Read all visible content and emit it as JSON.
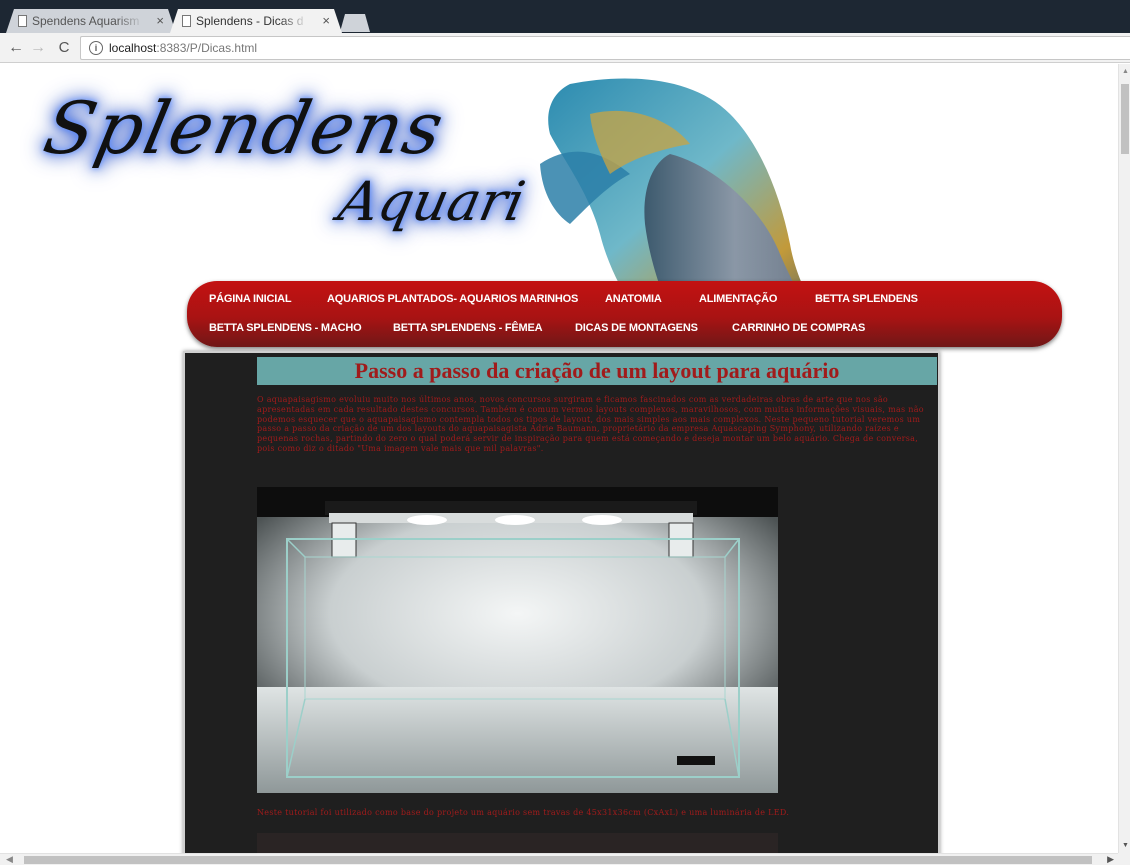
{
  "browser": {
    "tabs": [
      {
        "title": "Spendens Aquarism",
        "active": false
      },
      {
        "title": "Splendens - Dicas d",
        "active": true
      }
    ],
    "url_host": "localhost",
    "url_path": ":8383/P/Dicas.html"
  },
  "logo": {
    "line1": "Splendens",
    "line2": "Aquari"
  },
  "menu": {
    "items": [
      "PÁGINA INICIAL",
      "AQUARIOS PLANTADOS- AQUARIOS MARINHOS",
      "ANATOMIA",
      "ALIMENTAÇÃO",
      "BETTA SPLENDENS",
      "BETTA SPLENDENS - MACHO",
      "BETTA SPLENDENS - FÊMEA",
      "DICAS DE MONTAGENS",
      "CARRINHO DE COMPRAS"
    ]
  },
  "article": {
    "title": "Passo a passo da criação de um layout para aquário",
    "intro": "O aquapaisagismo evoluiu muito nos últimos anos, novos concursos surgiram e ficamos fascinados com as verdadeiras obras de arte que nos são apresentadas em cada resultado destes concursos. Também é comum vermos layouts complexos, maravilhosos, com muitas informações visuais, mas não podemos esquecer que o aquapaisagismo contempla todos os tipos de layout, dos mais simples aos mais complexos. Neste pequeno tutorial veremos um passo a passo da criação de um dos layouts do aquapaisagista Adrie Baumann, proprietário da empresa Aquascaping Symphony, utilizando raízes e pequenas rochas, partindo do zero o qual poderá servir de inspiração para quem está começando e deseja montar um belo aquário. Chega de conversa, pois como diz o ditado \"Uma imagem vale mais que mil palavras\".",
    "caption": "Neste tutorial foi utilizado como base do projeto um aquário sem travas de 45x31x36cm (CxAxL) e uma luminária de LED."
  },
  "colors": {
    "menu_red": "#b51212",
    "text_red": "#a01b1b",
    "title_bar": "#67a6a6",
    "content_bg": "#1f1f1f"
  }
}
